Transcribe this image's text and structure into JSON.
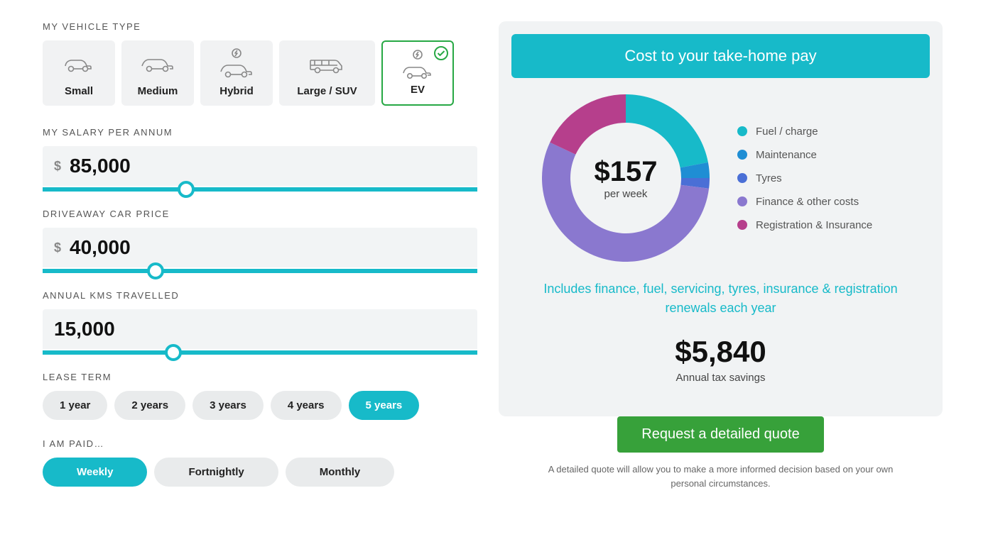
{
  "vehicle": {
    "section_label": "MY VEHICLE TYPE",
    "types": [
      {
        "label": "Small"
      },
      {
        "label": "Medium"
      },
      {
        "label": "Hybrid"
      },
      {
        "label": "Large / SUV"
      },
      {
        "label": "EV"
      }
    ],
    "selected": "EV"
  },
  "salary": {
    "label": "MY SALARY PER ANNUM",
    "currency": "$",
    "value": "85,000",
    "thumb_pct": 33
  },
  "price": {
    "label": "DRIVEAWAY CAR PRICE",
    "currency": "$",
    "value": "40,000",
    "thumb_pct": 26
  },
  "kms": {
    "label": "ANNUAL KMS TRAVELLED",
    "value": "15,000",
    "thumb_pct": 30
  },
  "lease_term": {
    "label": "LEASE TERM",
    "options": [
      "1 year",
      "2 years",
      "3 years",
      "4 years",
      "5 years"
    ],
    "selected": "5 years"
  },
  "paid": {
    "label": "I AM PAID…",
    "options": [
      "Weekly",
      "Fortnightly",
      "Monthly"
    ],
    "selected": "Weekly"
  },
  "result": {
    "header": "Cost to your take-home pay",
    "cost": "$157",
    "cost_unit": "per week",
    "includes": "Includes finance, fuel, servicing, tyres, insurance & registration renewals each year",
    "savings": "$5,840",
    "savings_label": "Annual tax savings",
    "cta": "Request a detailed quote",
    "fineprint": "A detailed quote will allow you to make a more informed decision based on your own personal circumstances."
  },
  "chart_data": {
    "type": "pie",
    "title": "Cost to your take-home pay",
    "series": [
      {
        "name": "Fuel / charge",
        "value": 22,
        "color": "#17bac9"
      },
      {
        "name": "Maintenance",
        "value": 3,
        "color": "#1f8ed4"
      },
      {
        "name": "Tyres",
        "value": 2,
        "color": "#4a6fd6"
      },
      {
        "name": "Finance & other costs",
        "value": 55,
        "color": "#8a78cf"
      },
      {
        "name": "Registration & Insurance",
        "value": 18,
        "color": "#b63f8c"
      }
    ],
    "center_value": "$157",
    "center_unit": "per week"
  }
}
